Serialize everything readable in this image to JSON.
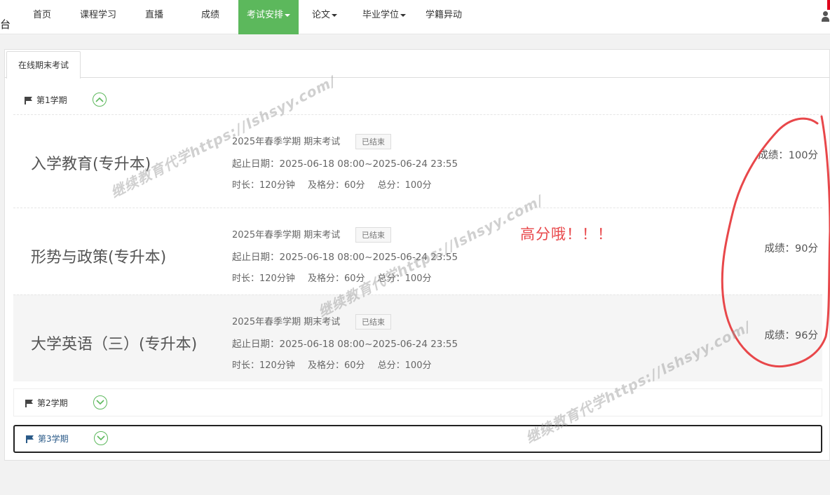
{
  "nav": {
    "brand_fragment": "台",
    "items": [
      {
        "label": "首页",
        "dropdown": false,
        "active": false
      },
      {
        "label": "课程学习",
        "dropdown": false,
        "active": false
      },
      {
        "label": "直播",
        "dropdown": false,
        "active": false
      },
      {
        "label": "成绩",
        "dropdown": false,
        "active": false
      },
      {
        "label": "考试安排",
        "dropdown": true,
        "active": true
      },
      {
        "label": "论文",
        "dropdown": true,
        "active": false
      },
      {
        "label": "毕业学位",
        "dropdown": true,
        "active": false
      },
      {
        "label": "学籍异动",
        "dropdown": false,
        "active": false
      }
    ],
    "active_color": "#5cb85c"
  },
  "tab": {
    "label": "在线期末考试"
  },
  "terms": [
    {
      "label": "第1学期",
      "expanded": true,
      "courses": [
        {
          "name": "入学教育(专升本)",
          "exam_title": "2025年春季学期 期末考试",
          "status": "已结束",
          "date": "起止日期：2025-06-18 08:00~2025-06-24 23:55",
          "duration": "时长：120分钟",
          "pass": "及格分：60分",
          "total": "总分：100分",
          "score": "成绩：100分"
        },
        {
          "name": "形势与政策(专升本)",
          "exam_title": "2025年春季学期 期末考试",
          "status": "已结束",
          "date": "起止日期：2025-06-18 08:00~2025-06-24 23:55",
          "duration": "时长：120分钟",
          "pass": "及格分：60分",
          "total": "总分：100分",
          "score": "成绩：90分"
        },
        {
          "name": "大学英语（三）(专升本)",
          "exam_title": "2025年春季学期 期末考试",
          "status": "已结束",
          "date": "起止日期：2025-06-18 08:00~2025-06-24 23:55",
          "duration": "时长：120分钟",
          "pass": "及格分：60分",
          "total": "总分：100分",
          "score": "成绩：96分"
        }
      ]
    },
    {
      "label": "第2学期",
      "expanded": false
    },
    {
      "label": "第3学期",
      "expanded": false
    }
  ],
  "annotation": {
    "text": "高分哦！！！",
    "color": "#e8474a"
  },
  "watermark": {
    "text": "继续教育代学https://lshsyy.com/"
  },
  "icons": {
    "flag": "flag-icon",
    "toggle_up": "chevron-up-circle-icon",
    "toggle_down": "chevron-down-circle-icon",
    "user": "user-icon"
  }
}
